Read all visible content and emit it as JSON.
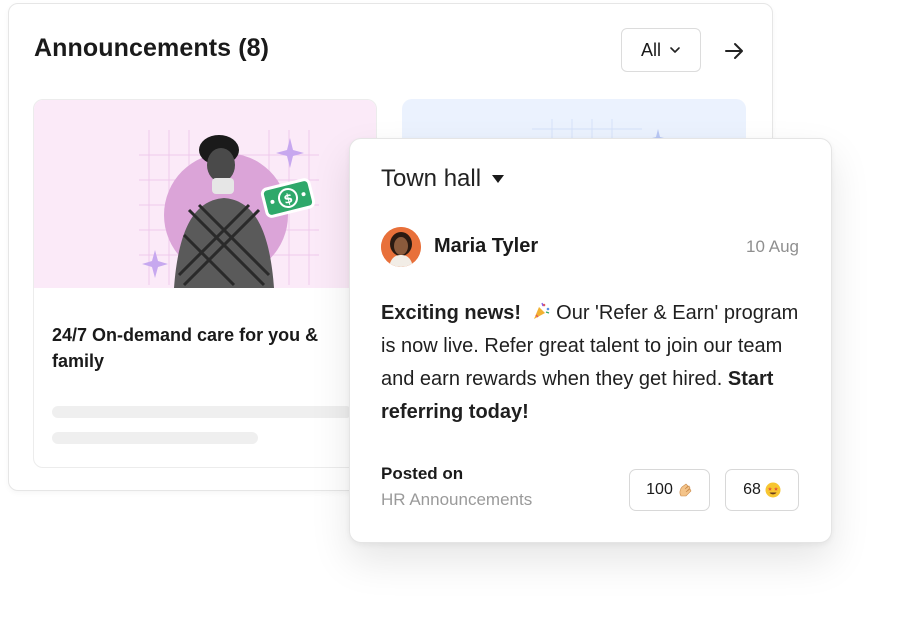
{
  "panel": {
    "title": "Announcements (8)",
    "filter_value": "All"
  },
  "card": {
    "title": "24/7 On-demand care for you & family"
  },
  "popup": {
    "channel": "Town hall",
    "author": "Maria Tyler",
    "date": "10 Aug",
    "message_lead": "Exciting news!",
    "message_body": " Our 'Refer & Earn' program is now live. Refer great talent to join our team and earn rewards when they get hired. ",
    "message_cta": "Start referring today!",
    "posted_label": "Posted on",
    "posted_channel": "HR Announcements",
    "reactions": [
      {
        "count": "100",
        "icon": "clapping-hands-icon"
      },
      {
        "count": "68",
        "icon": "star-struck-icon"
      }
    ]
  },
  "colors": {
    "card_art_bg": "#fbeaf8",
    "accent_green": "#2ea86a",
    "avatar_bg": "#e8703a",
    "muted_text": "#8f8f8f"
  }
}
